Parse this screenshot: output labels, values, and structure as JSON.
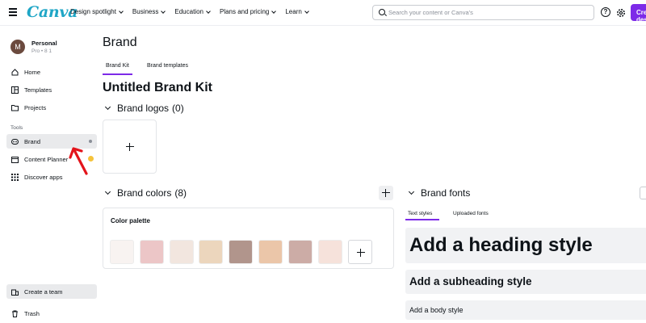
{
  "header": {
    "logo": "Canva",
    "nav": [
      {
        "label": "Design spotlight"
      },
      {
        "label": "Business"
      },
      {
        "label": "Education"
      },
      {
        "label": "Plans and pricing"
      },
      {
        "label": "Learn"
      }
    ],
    "search_placeholder": "Search your content or Canva's",
    "help_label": "?",
    "create_label": "Create a design",
    "accent_color": "#7d2ae8"
  },
  "sidebar": {
    "account": {
      "initial": "M",
      "name": "Personal",
      "plan": "Pro • 8 1"
    },
    "items": [
      {
        "label": "Home",
        "icon": "home-icon"
      },
      {
        "label": "Templates",
        "icon": "templates-icon"
      },
      {
        "label": "Projects",
        "icon": "folder-icon"
      }
    ],
    "tools_label": "Tools",
    "tools": [
      {
        "label": "Brand",
        "icon": "brand-icon",
        "active": true
      },
      {
        "label": "Content Planner",
        "icon": "calendar-icon"
      },
      {
        "label": "Discover apps",
        "icon": "apps-grid-icon"
      }
    ],
    "bottom": [
      {
        "label": "Create a team",
        "icon": "team-icon"
      },
      {
        "label": "Trash",
        "icon": "trash-icon"
      }
    ]
  },
  "main": {
    "title": "Brand",
    "tabs": [
      {
        "label": "Brand Kit",
        "active": true
      },
      {
        "label": "Brand templates",
        "active": false
      }
    ],
    "kit_title": "Untitled Brand Kit",
    "logos": {
      "label": "Brand logos",
      "count": "(0)"
    },
    "colors": {
      "label": "Brand colors",
      "count": "(8)",
      "palette_label": "Color palette",
      "swatches": [
        "#f8f3f1",
        "#ecc6c7",
        "#f2e6df",
        "#ecd6bd",
        "#b1958c",
        "#ebc6a9",
        "#ccaca6",
        "#f6e2db"
      ]
    },
    "fonts": {
      "label": "Brand fonts",
      "tabs": [
        {
          "label": "Text styles",
          "active": true
        },
        {
          "label": "Uploaded fonts",
          "active": false
        }
      ],
      "heading": "Add a heading style",
      "subheading": "Add a subheading style",
      "body": "Add a body style"
    }
  }
}
